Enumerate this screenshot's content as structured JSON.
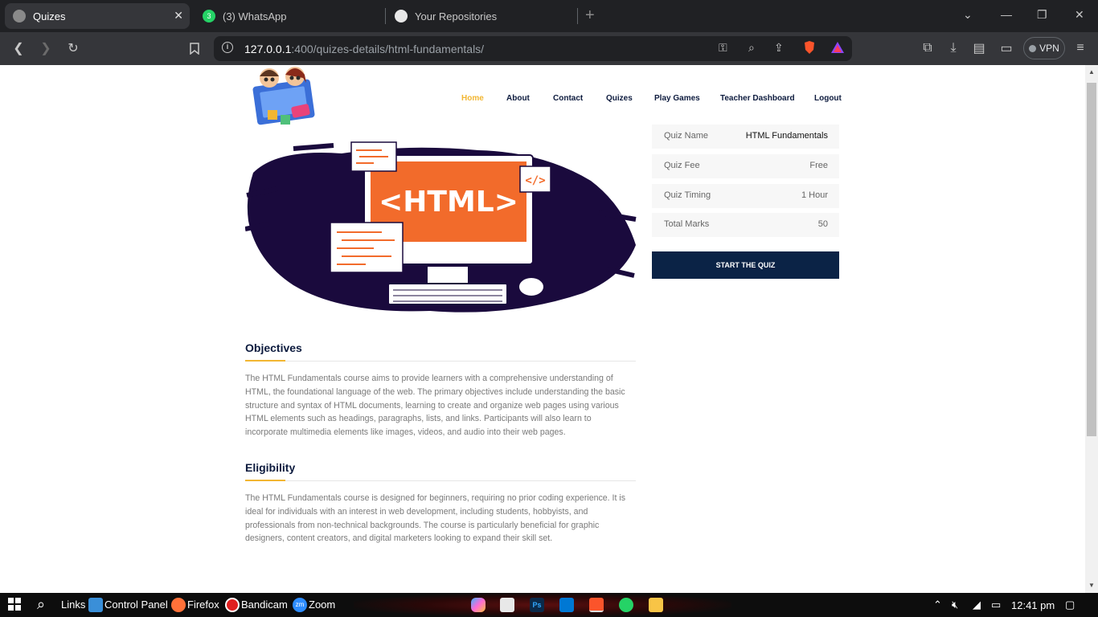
{
  "browser": {
    "tabs": [
      {
        "title": "Quizes",
        "icon": "globe-icon"
      },
      {
        "title": "(3) WhatsApp",
        "icon": "whatsapp-icon",
        "badge": "3"
      },
      {
        "title": "Your Repositories",
        "icon": "github-icon"
      }
    ],
    "new_tab_label": "+",
    "url_host": "127.0.0.1",
    "url_rest": ":400/quizes-details/html-fundamentals/",
    "vpn_label": "VPN"
  },
  "site": {
    "nav": [
      "Home",
      "About",
      "Contact",
      "Quizes",
      "Play Games",
      "Teacher Dashboard",
      "Logout"
    ],
    "hero_text": "<HTML>",
    "hero_tag": "</>",
    "quiz": {
      "name_label": "Quiz Name",
      "name_value": "HTML Fundamentals",
      "fee_label": "Quiz Fee",
      "fee_value": "Free",
      "timing_label": "Quiz Timing",
      "timing_value": "1 Hour",
      "marks_label": "Total Marks",
      "marks_value": "50",
      "start_label": "START THE QUIZ"
    },
    "objectives": {
      "title": "Objectives",
      "lines": [
        "The HTML Fundamentals course aims to provide learners with a comprehensive understanding of",
        "HTML, the foundational language of the web. The primary objectives include understanding the basic",
        "structure and syntax of HTML documents, learning to create and organize web pages using various",
        "HTML elements such as headings, paragraphs, lists, and links. Participants will also learn to",
        "incorporate multimedia elements like images, videos, and audio into their web pages."
      ]
    },
    "eligibility": {
      "title": "Eligibility",
      "lines": [
        "The HTML Fundamentals course is designed for beginners, requiring no prior coding experience. It is",
        "ideal for individuals with an interest in web development, including students, hobbyists, and",
        "professionals from non-technical backgrounds. The course is particularly beneficial for graphic",
        "designers, content creators, and digital marketers looking to expand their skill set."
      ]
    }
  },
  "taskbar": {
    "items": [
      "Links",
      "Control Panel",
      "Firefox",
      "Bandicam",
      "Zoom"
    ],
    "zoom_badge": "zm",
    "time": "12:41 pm"
  },
  "colors": {
    "accent": "#f2b632",
    "navy": "#0b2346",
    "hero_orange": "#f26b2b",
    "hero_ink": "#1a0a3d"
  }
}
